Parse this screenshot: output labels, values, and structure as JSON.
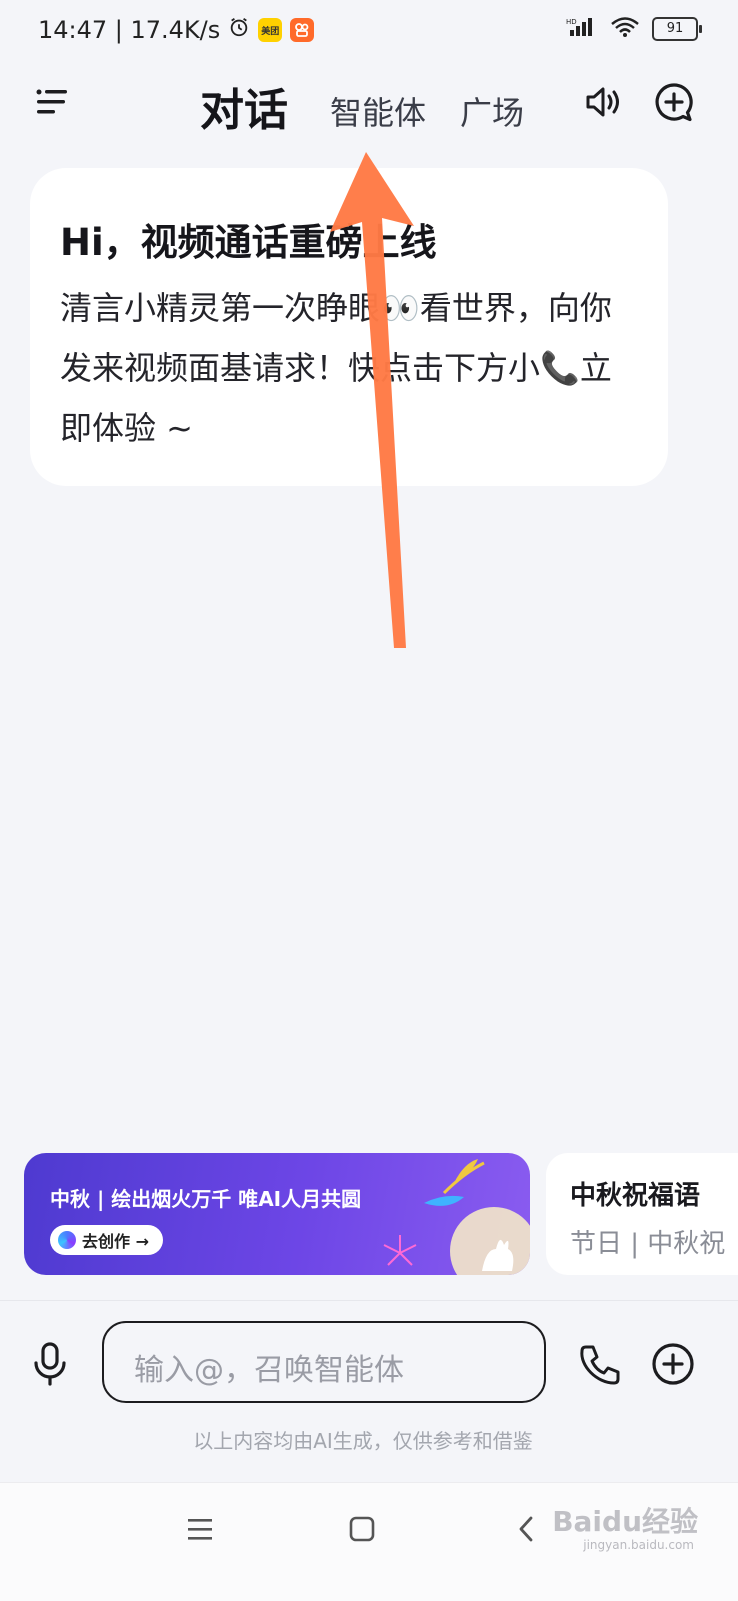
{
  "status_bar": {
    "time_speed": "14:47 | 17.4K/s",
    "battery": "91",
    "app_badge_meituan": "美团"
  },
  "header": {
    "tab_chat": "对话",
    "tab_agents": "智能体",
    "tab_square": "广场"
  },
  "welcome": {
    "title": "Hi，视频通话重磅上线",
    "body": "清言小精灵第一次睁眼👀看世界，向你发来视频面基请求！快点击下方小📞立即体验 ~"
  },
  "promo": {
    "title": "中秋 | 绘出烟火万千  唯AI人月共圆",
    "button": "去创作 →"
  },
  "side_card": {
    "title": "中秋祝福语",
    "subtitle": "节日 | 中秋祝"
  },
  "input": {
    "placeholder": "输入@，召唤智能体"
  },
  "disclaimer": "以上内容均由AI生成，仅供参考和借鉴",
  "watermark": {
    "text": "Baidu经验",
    "sub": "jingyan.baidu.com"
  },
  "colors": {
    "accent_arrow": "#ff7a45",
    "background": "#f4f5f9",
    "promo_purple": "#5b3fe0"
  },
  "icons": [
    "menu-icon",
    "speaker-icon",
    "new-chat-icon",
    "mic-icon",
    "phone-icon",
    "plus-icon",
    "alarm-icon",
    "wifi-icon",
    "signal-icon",
    "recent-apps-icon",
    "home-icon",
    "back-icon"
  ]
}
